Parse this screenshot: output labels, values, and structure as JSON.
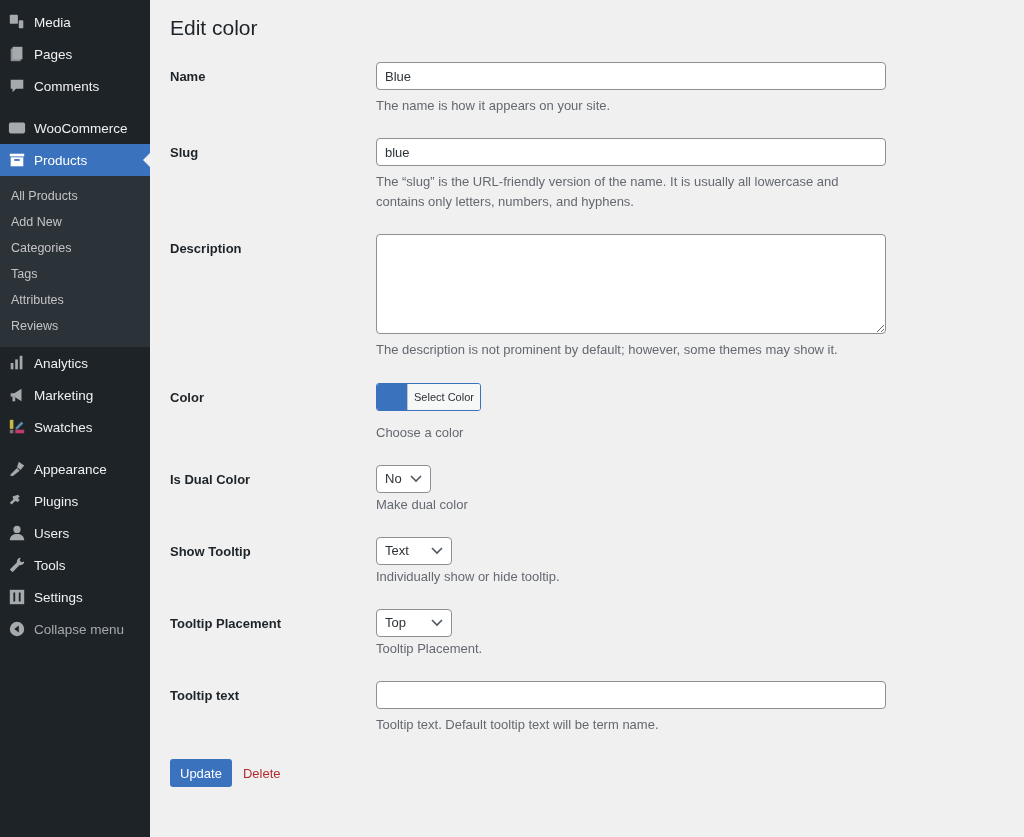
{
  "sidebar": {
    "groups": [
      [
        {
          "label": "Media",
          "selected": false
        },
        {
          "label": "Pages",
          "selected": false
        },
        {
          "label": "Comments",
          "selected": false
        }
      ],
      [
        {
          "label": "WooCommerce",
          "selected": false
        },
        {
          "label": "Products",
          "selected": true,
          "children": [
            {
              "label": "All Products",
              "selected": false
            },
            {
              "label": "Add New",
              "selected": false
            },
            {
              "label": "Categories",
              "selected": false
            },
            {
              "label": "Tags",
              "selected": false
            },
            {
              "label": "Attributes",
              "selected": false
            },
            {
              "label": "Reviews",
              "selected": false
            }
          ]
        },
        {
          "label": "Analytics",
          "selected": false
        },
        {
          "label": "Marketing",
          "selected": false
        },
        {
          "label": "Swatches",
          "selected": false
        }
      ],
      [
        {
          "label": "Appearance",
          "selected": false
        },
        {
          "label": "Plugins",
          "selected": false
        },
        {
          "label": "Users",
          "selected": false
        },
        {
          "label": "Tools",
          "selected": false
        },
        {
          "label": "Settings",
          "selected": false
        },
        {
          "label": "Collapse menu",
          "selected": false
        }
      ]
    ]
  },
  "page": {
    "title": "Edit color",
    "fields": [
      {
        "kind": "text",
        "label": "Name",
        "value": "Blue",
        "hint": "The name is how it appears on your site."
      },
      {
        "kind": "text",
        "label": "Slug",
        "value": "blue",
        "hint": "The “slug” is the URL-friendly version of the name. It is usually all lowercase and contains only letters, numbers, and hyphens."
      },
      {
        "kind": "textarea",
        "label": "Description",
        "hint": "The description is not prominent by default; however, some themes may show it."
      },
      {
        "kind": "color",
        "label": "Color",
        "button": "Select Color",
        "color": "#3a72be",
        "hint": "Choose a color"
      },
      {
        "kind": "select",
        "label": "Is Dual Color",
        "value": "No",
        "hint": "Make dual color"
      },
      {
        "kind": "select",
        "label": "Show Tooltip",
        "value": "Text",
        "hint": "Individually show or hide tooltip."
      },
      {
        "kind": "select",
        "label": "Tooltip Placement",
        "value": "Top",
        "hint": "Tooltip Placement."
      },
      {
        "kind": "text",
        "label": "Tooltip text",
        "hint": "Tooltip text. Default tooltip text will be term name."
      }
    ],
    "buttons": {
      "update": "Update",
      "delete": "Delete"
    }
  }
}
